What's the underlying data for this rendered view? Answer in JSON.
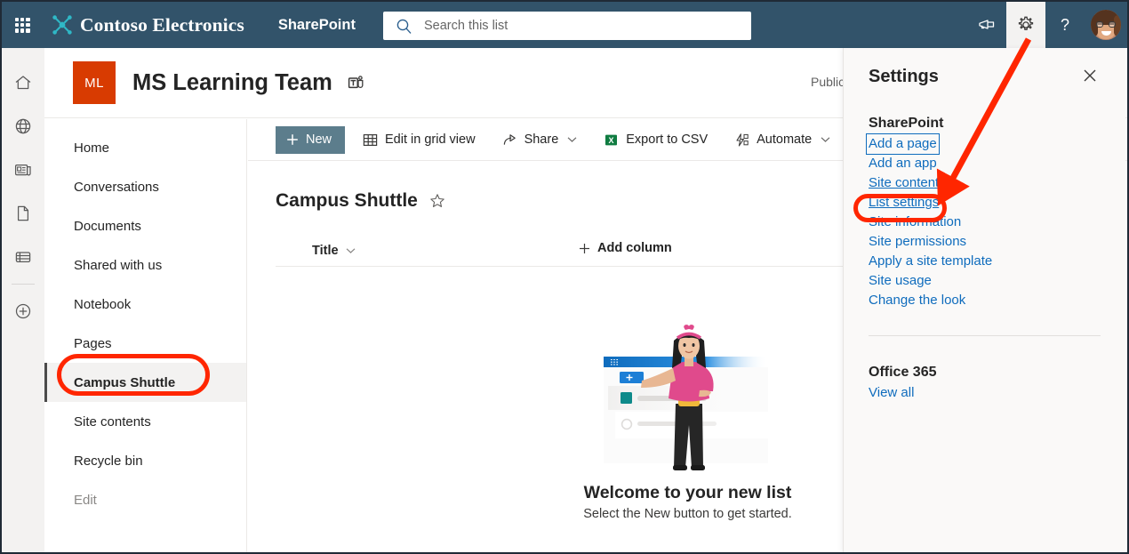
{
  "suite": {
    "waffle_label": "App launcher",
    "brand_name": "Contoso Electronics",
    "app_name": "SharePoint",
    "search_placeholder": "Search this list",
    "search_value": "",
    "icons": {
      "waffle": "waffle-icon",
      "search": "search-icon",
      "megaphone": "megaphone-icon",
      "gear": "gear-icon",
      "help": "help-icon",
      "avatar": "user-avatar"
    }
  },
  "rail": {
    "items": [
      {
        "name": "home-icon",
        "label": "Home"
      },
      {
        "name": "globe-icon",
        "label": "My sites"
      },
      {
        "name": "news-icon",
        "label": "News"
      },
      {
        "name": "document-icon",
        "label": "Files"
      },
      {
        "name": "list-icon",
        "label": "Lists"
      },
      {
        "name": "plus-circle-icon",
        "label": "Create"
      }
    ]
  },
  "site": {
    "logo_initials": "ML",
    "logo_color": "#d83b01",
    "title": "MS Learning Team",
    "teams_icon": "teams-icon",
    "privacy": "Public"
  },
  "nav": {
    "items": [
      {
        "label": "Home",
        "selected": false,
        "muted": false
      },
      {
        "label": "Conversations",
        "selected": false,
        "muted": false
      },
      {
        "label": "Documents",
        "selected": false,
        "muted": false
      },
      {
        "label": "Shared with us",
        "selected": false,
        "muted": false
      },
      {
        "label": "Notebook",
        "selected": false,
        "muted": false
      },
      {
        "label": "Pages",
        "selected": false,
        "muted": false
      },
      {
        "label": "Campus Shuttle",
        "selected": true,
        "muted": false
      },
      {
        "label": "Site contents",
        "selected": false,
        "muted": false
      },
      {
        "label": "Recycle bin",
        "selected": false,
        "muted": false
      },
      {
        "label": "Edit",
        "selected": false,
        "muted": true
      }
    ]
  },
  "commandbar": {
    "new_label": "New",
    "edit_grid_label": "Edit in grid view",
    "share_label": "Share",
    "export_label": "Export to CSV",
    "automate_label": "Automate",
    "more_label": "..."
  },
  "list": {
    "title": "Campus Shuttle",
    "favorite_icon": "star-icon",
    "column_header": "Title",
    "add_column_label": "Add column",
    "empty_heading": "Welcome to your new list",
    "empty_subtext": "Select the New button to get started."
  },
  "panel": {
    "title": "Settings",
    "close_label": "Close",
    "sections": [
      {
        "heading": "SharePoint",
        "links": [
          {
            "label": "Add a page",
            "state": "focused"
          },
          {
            "label": "Add an app",
            "state": "normal"
          },
          {
            "label": "Site contents",
            "state": "underlined"
          },
          {
            "label": "List settings",
            "state": "underlined"
          },
          {
            "label": "Site information",
            "state": "normal"
          },
          {
            "label": "Site permissions",
            "state": "normal"
          },
          {
            "label": "Apply a site template",
            "state": "normal"
          },
          {
            "label": "Site usage",
            "state": "normal"
          },
          {
            "label": "Change the look",
            "state": "normal"
          }
        ]
      },
      {
        "heading": "Office 365",
        "links": [
          {
            "label": "View all",
            "state": "normal"
          }
        ]
      }
    ]
  },
  "annotations": {
    "color": "#ff2600",
    "arrow_from": "gear-icon",
    "arrow_to": "List settings",
    "highlighted_nav_item": "Campus Shuttle",
    "highlighted_panel_link": "List settings"
  }
}
